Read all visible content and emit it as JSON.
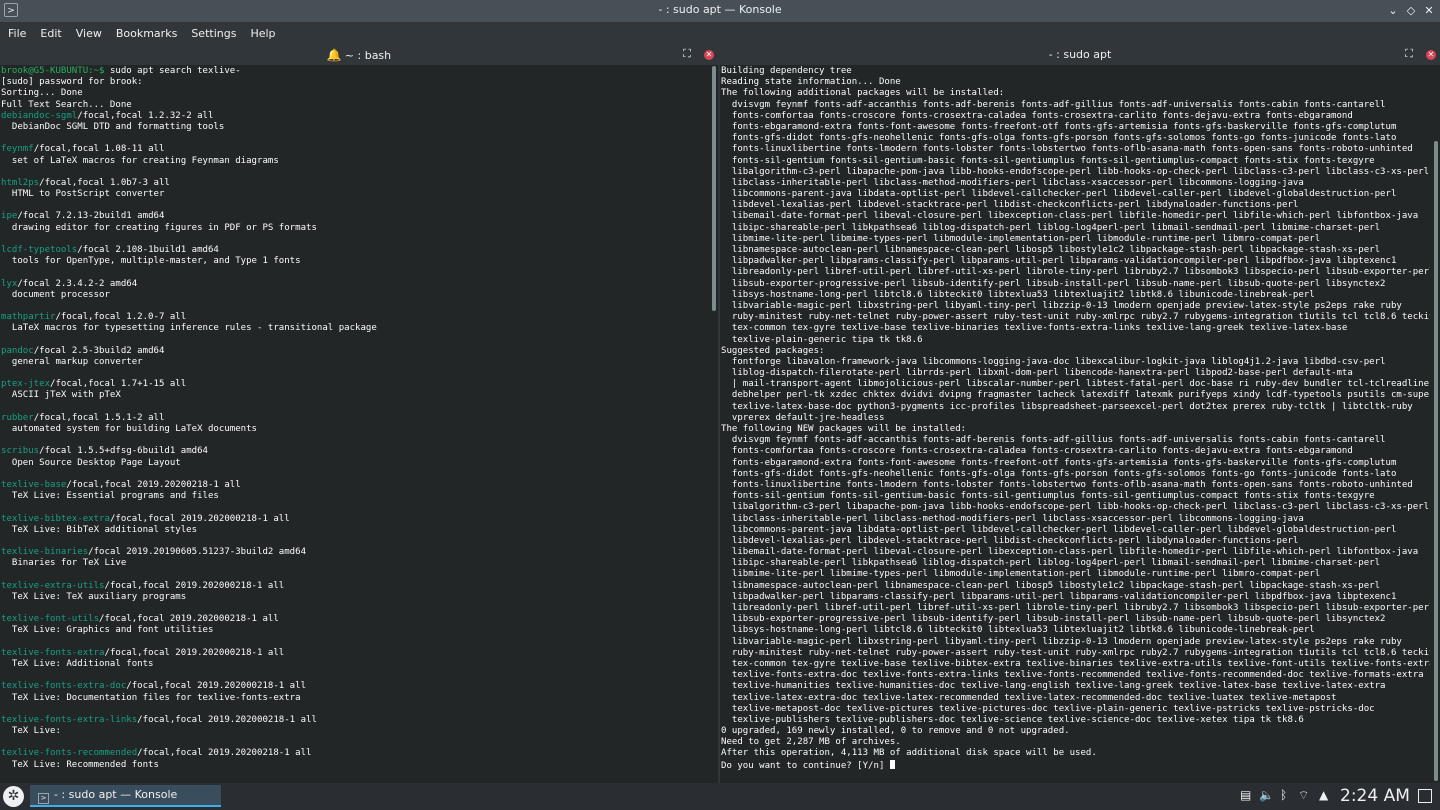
{
  "window": {
    "title": "- : sudo apt — Konsole",
    "buttons": [
      "⌄",
      "◇",
      "✕"
    ]
  },
  "menu": [
    "File",
    "Edit",
    "View",
    "Bookmarks",
    "Settings",
    "Help"
  ],
  "left_pane": {
    "tab_title": "~ : bash",
    "lines": [
      [
        {
          "t": "brook@G5-KUBUNTU:~$ ",
          "c": "g"
        },
        {
          "t": "sudo apt search texlive-"
        }
      ],
      [
        {
          "t": "[sudo] password for brook:"
        }
      ],
      [
        {
          "t": "Sorting... Done"
        }
      ],
      [
        {
          "t": "Full Text Search... Done"
        }
      ],
      [
        {
          "t": "debiandoc-sgml",
          "c": "t"
        },
        {
          "t": "/focal,focal 1.2.32-2 all"
        }
      ],
      [
        {
          "t": "  DebianDoc SGML DTD and formatting tools"
        }
      ],
      [],
      [
        {
          "t": "feynmf",
          "c": "t"
        },
        {
          "t": "/focal,focal 1.08-11 all"
        }
      ],
      [
        {
          "t": "  set of LaTeX macros for creating Feynman diagrams"
        }
      ],
      [],
      [
        {
          "t": "html2ps",
          "c": "t"
        },
        {
          "t": "/focal,focal 1.0b7-3 all"
        }
      ],
      [
        {
          "t": "  HTML to PostScript converter"
        }
      ],
      [],
      [
        {
          "t": "ipe",
          "c": "t"
        },
        {
          "t": "/focal 7.2.13-2build1 amd64"
        }
      ],
      [
        {
          "t": "  drawing editor for creating figures in PDF or PS formats"
        }
      ],
      [],
      [
        {
          "t": "lcdf-typetools",
          "c": "t"
        },
        {
          "t": "/focal 2.108-1build1 amd64"
        }
      ],
      [
        {
          "t": "  tools for OpenType, multiple-master, and Type 1 fonts"
        }
      ],
      [],
      [
        {
          "t": "lyx",
          "c": "t"
        },
        {
          "t": "/focal 2.3.4.2-2 amd64"
        }
      ],
      [
        {
          "t": "  document processor"
        }
      ],
      [],
      [
        {
          "t": "mathpartir",
          "c": "t"
        },
        {
          "t": "/focal,focal 1.2.0-7 all"
        }
      ],
      [
        {
          "t": "  LaTeX macros for typesetting inference rules - transitional package"
        }
      ],
      [],
      [
        {
          "t": "pandoc",
          "c": "t"
        },
        {
          "t": "/focal 2.5-3build2 amd64"
        }
      ],
      [
        {
          "t": "  general markup converter"
        }
      ],
      [],
      [
        {
          "t": "ptex-jtex",
          "c": "t"
        },
        {
          "t": "/focal,focal 1.7+1-15 all"
        }
      ],
      [
        {
          "t": "  ASCII jTeX with pTeX"
        }
      ],
      [],
      [
        {
          "t": "rubber",
          "c": "t"
        },
        {
          "t": "/focal,focal 1.5.1-2 all"
        }
      ],
      [
        {
          "t": "  automated system for building LaTeX documents"
        }
      ],
      [],
      [
        {
          "t": "scribus",
          "c": "t"
        },
        {
          "t": "/focal 1.5.5+dfsg-6build1 amd64"
        }
      ],
      [
        {
          "t": "  Open Source Desktop Page Layout"
        }
      ],
      [],
      [
        {
          "t": "texlive-base",
          "c": "t"
        },
        {
          "t": "/focal,focal 2019.20200218-1 all"
        }
      ],
      [
        {
          "t": "  TeX Live: Essential programs and files"
        }
      ],
      [],
      [
        {
          "t": "texlive-bibtex-extra",
          "c": "t"
        },
        {
          "t": "/focal,focal 2019.202000218-1 all"
        }
      ],
      [
        {
          "t": "  TeX Live: BibTeX additional styles"
        }
      ],
      [],
      [
        {
          "t": "texlive-binaries",
          "c": "t"
        },
        {
          "t": "/focal 2019.20190605.51237-3build2 amd64"
        }
      ],
      [
        {
          "t": "  Binaries for TeX Live"
        }
      ],
      [],
      [
        {
          "t": "texlive-extra-utils",
          "c": "t"
        },
        {
          "t": "/focal,focal 2019.202000218-1 all"
        }
      ],
      [
        {
          "t": "  TeX Live: TeX auxiliary programs"
        }
      ],
      [],
      [
        {
          "t": "texlive-font-utils",
          "c": "t"
        },
        {
          "t": "/focal,focal 2019.202000218-1 all"
        }
      ],
      [
        {
          "t": "  TeX Live: Graphics and font utilities"
        }
      ],
      [],
      [
        {
          "t": "texlive-fonts-extra",
          "c": "t"
        },
        {
          "t": "/focal,focal 2019.202000218-1 all"
        }
      ],
      [
        {
          "t": "  TeX Live: Additional fonts"
        }
      ],
      [],
      [
        {
          "t": "texlive-fonts-extra-doc",
          "c": "t"
        },
        {
          "t": "/focal,focal 2019.202000218-1 all"
        }
      ],
      [
        {
          "t": "  TeX Live: Documentation files for texlive-fonts-extra"
        }
      ],
      [],
      [
        {
          "t": "texlive-fonts-extra-links",
          "c": "t"
        },
        {
          "t": "/focal,focal 2019.202000218-1 all"
        }
      ],
      [
        {
          "t": "  TeX Live:"
        }
      ],
      [],
      [
        {
          "t": "texlive-fonts-recommended",
          "c": "t"
        },
        {
          "t": "/focal,focal 2019.20200218-1 all"
        }
      ],
      [
        {
          "t": "  TeX Live: Recommended fonts"
        }
      ]
    ]
  },
  "right_pane": {
    "tab_title": "- : sudo apt",
    "lines": [
      "Building dependency tree",
      "Reading state information... Done",
      "The following additional packages will be installed:",
      "  dvisvgm feynmf fonts-adf-accanthis fonts-adf-berenis fonts-adf-gillius fonts-adf-universalis fonts-cabin fonts-cantarell",
      "  fonts-comfortaa fonts-croscore fonts-crosextra-caladea fonts-crosextra-carlito fonts-dejavu-extra fonts-ebgaramond",
      "  fonts-ebgaramond-extra fonts-font-awesome fonts-freefont-otf fonts-gfs-artemisia fonts-gfs-baskerville fonts-gfs-complutum",
      "  fonts-gfs-didot fonts-gfs-neohellenic fonts-gfs-olga fonts-gfs-porson fonts-gfs-solomos fonts-go fonts-junicode fonts-lato",
      "  fonts-linuxlibertine fonts-lmodern fonts-lobster fonts-lobstertwo fonts-oflb-asana-math fonts-open-sans fonts-roboto-unhinted",
      "  fonts-sil-gentium fonts-sil-gentium-basic fonts-sil-gentiumplus fonts-sil-gentiumplus-compact fonts-stix fonts-texgyre",
      "  libalgorithm-c3-perl libapache-pom-java libb-hooks-endofscope-perl libb-hooks-op-check-perl libclass-c3-perl libclass-c3-xs-perl",
      "  libclass-inheritable-perl libclass-method-modifiers-perl libclass-xsaccessor-perl libcommons-logging-java",
      "  libcommons-parent-java libdata-optlist-perl libdevel-callchecker-perl libdevel-caller-perl libdevel-globaldestruction-perl",
      "  libdevel-lexalias-perl libdevel-stacktrace-perl libdist-checkconflicts-perl libdynaloader-functions-perl",
      "  libemail-date-format-perl libeval-closure-perl libexception-class-perl libfile-homedir-perl libfile-which-perl libfontbox-java",
      "  libipc-shareable-perl libkpathsea6 liblog-dispatch-perl liblog-log4perl-perl libmail-sendmail-perl libmime-charset-perl",
      "  libmime-lite-perl libmime-types-perl libmodule-implementation-perl libmodule-runtime-perl libmro-compat-perl",
      "  libnamespace-autoclean-perl libnamespace-clean-perl libosp5 libostyle1c2 libpackage-stash-perl libpackage-stash-xs-perl",
      "  libpadwalker-perl libparams-classify-perl libparams-util-perl libparams-validationcompiler-perl libpdfbox-java libptexenc1",
      "  libreadonly-perl libref-util-perl libref-util-xs-perl librole-tiny-perl libruby2.7 libsombok3 libspecio-perl libsub-exporter-perl",
      "  libsub-exporter-progressive-perl libsub-identify-perl libsub-install-perl libsub-name-perl libsub-quote-perl libsynctex2",
      "  libsys-hostname-long-perl libtcl8.6 libteckit0 libtexlua53 libtexluajit2 libtk8.6 libunicode-linebreak-perl",
      "  libvariable-magic-perl libxstring-perl libyaml-tiny-perl libzzip-0-13 lmodern openjade preview-latex-style ps2eps rake ruby",
      "  ruby-minitest ruby-net-telnet ruby-power-assert ruby-test-unit ruby-xmlrpc ruby2.7 rubygems-integration t1utils tcl tcl8.6 teckit",
      "  tex-common tex-gyre texlive-base texlive-binaries texlive-fonts-extra-links texlive-lang-greek texlive-latex-base",
      "  texlive-plain-generic tipa tk tk8.6",
      "Suggested packages:",
      "  fontforge libavalon-framework-java libcommons-logging-java-doc libexcalibur-logkit-java liblog4j1.2-java libdbd-csv-perl",
      "  liblog-dispatch-filerotate-perl librrds-perl libxml-dom-perl libencode-hanextra-perl libpod2-base-perl default-mta",
      "  | mail-transport-agent libmojolicious-perl libscalar-number-perl libtest-fatal-perl doc-base ri ruby-dev bundler tcl-tclreadline",
      "  debhelper perl-tk xzdec chktex dvidvi dvipng fragmaster lacheck latexdiff latexmk purifyeps xindy lcdf-typetools psutils cm-super",
      "  texlive-latex-base-doc python3-pygments icc-profiles libspreadsheet-parseexcel-perl dot2tex prerex ruby-tcltk | libtcltk-ruby",
      "  vprerex default-jre-headless",
      "The following NEW packages will be installed:",
      "  dvisvgm feynmf fonts-adf-accanthis fonts-adf-berenis fonts-adf-gillius fonts-adf-universalis fonts-cabin fonts-cantarell",
      "  fonts-comfortaa fonts-croscore fonts-crosextra-caladea fonts-crosextra-carlito fonts-dejavu-extra fonts-ebgaramond",
      "  fonts-ebgaramond-extra fonts-font-awesome fonts-freefont-otf fonts-gfs-artemisia fonts-gfs-baskerville fonts-gfs-complutum",
      "  fonts-gfs-didot fonts-gfs-neohellenic fonts-gfs-olga fonts-gfs-porson fonts-gfs-solomos fonts-go fonts-junicode fonts-lato",
      "  fonts-linuxlibertine fonts-lmodern fonts-lobster fonts-lobstertwo fonts-oflb-asana-math fonts-open-sans fonts-roboto-unhinted",
      "  fonts-sil-gentium fonts-sil-gentium-basic fonts-sil-gentiumplus fonts-sil-gentiumplus-compact fonts-stix fonts-texgyre",
      "  libalgorithm-c3-perl libapache-pom-java libb-hooks-endofscope-perl libb-hooks-op-check-perl libclass-c3-perl libclass-c3-xs-perl",
      "  libclass-inheritable-perl libclass-method-modifiers-perl libclass-xsaccessor-perl libcommons-logging-java",
      "  libcommons-parent-java libdata-optlist-perl libdevel-callchecker-perl libdevel-caller-perl libdevel-globaldestruction-perl",
      "  libdevel-lexalias-perl libdevel-stacktrace-perl libdist-checkconflicts-perl libdynaloader-functions-perl",
      "  libemail-date-format-perl libeval-closure-perl libexception-class-perl libfile-homedir-perl libfile-which-perl libfontbox-java",
      "  libipc-shareable-perl libkpathsea6 liblog-dispatch-perl liblog-log4perl-perl libmail-sendmail-perl libmime-charset-perl",
      "  libmime-lite-perl libmime-types-perl libmodule-implementation-perl libmodule-runtime-perl libmro-compat-perl",
      "  libnamespace-autoclean-perl libnamespace-clean-perl libosp5 libostyle1c2 libpackage-stash-perl libpackage-stash-xs-perl",
      "  libpadwalker-perl libparams-classify-perl libparams-util-perl libparams-validationcompiler-perl libpdfbox-java libptexenc1",
      "  libreadonly-perl libref-util-perl libref-util-xs-perl librole-tiny-perl libruby2.7 libsombok3 libspecio-perl libsub-exporter-perl",
      "  libsub-exporter-progressive-perl libsub-identify-perl libsub-install-perl libsub-name-perl libsub-quote-perl libsynctex2",
      "  libsys-hostname-long-perl libtcl8.6 libteckit0 libtexlua53 libtexluajit2 libtk8.6 libunicode-linebreak-perl",
      "  libvariable-magic-perl libxstring-perl libyaml-tiny-perl libzzip-0-13 lmodern openjade preview-latex-style ps2eps rake ruby",
      "  ruby-minitest ruby-net-telnet ruby-power-assert ruby-test-unit ruby-xmlrpc ruby2.7 rubygems-integration t1utils tcl tcl8.6 teckit",
      "  tex-common tex-gyre texlive-base texlive-bibtex-extra texlive-binaries texlive-extra-utils texlive-font-utils texlive-fonts-extra",
      "  texlive-fonts-extra-doc texlive-fonts-extra-links texlive-fonts-recommended texlive-fonts-recommended-doc texlive-formats-extra",
      "  texlive-humanities texlive-humanities-doc texlive-lang-english texlive-lang-greek texlive-latex-base texlive-latex-extra",
      "  texlive-latex-extra-doc texlive-latex-recommended texlive-latex-recommended-doc texlive-luatex texlive-metapost",
      "  texlive-metapost-doc texlive-pictures texlive-pictures-doc texlive-plain-generic texlive-pstricks texlive-pstricks-doc",
      "  texlive-publishers texlive-publishers-doc texlive-science texlive-science-doc texlive-xetex tipa tk tk8.6",
      "0 upgraded, 169 newly installed, 0 to remove and 0 not upgraded.",
      "Need to get 2,287 MB of archives.",
      "After this operation, 4,113 MB of additional disk space will be used.",
      "Do you want to continue? [Y/n] "
    ]
  },
  "taskbar": {
    "task_label": "- : sudo apt — Konsole",
    "clock": "2:24 AM",
    "tray_icons": [
      "clipboard-icon",
      "volume-icon",
      "bluetooth-icon",
      "network-icon",
      "expand-tray-icon"
    ]
  },
  "colors": {
    "prompt_green": "#27ae60",
    "package_teal": "#16a085",
    "text": "#fcfcfc",
    "background": "#232627"
  }
}
